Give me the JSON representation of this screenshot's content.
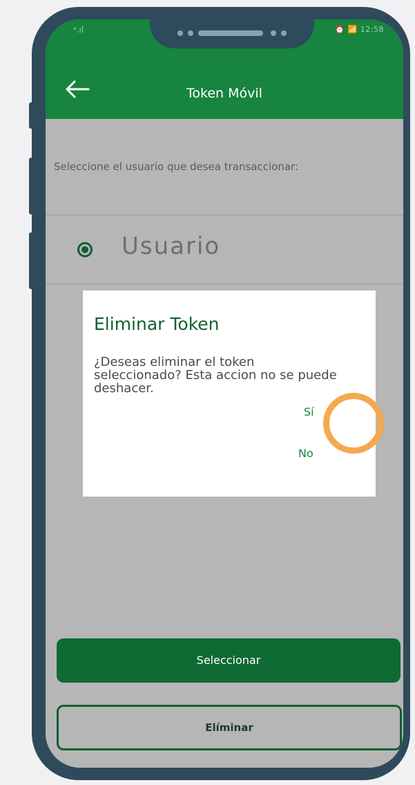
{
  "status_bar": {
    "signal": "ᵃ.ıl",
    "right": "⏰ 📶 12:58"
  },
  "header": {
    "back_icon": "arrow-left-icon",
    "title": "Token Móvil"
  },
  "main": {
    "prompt": "Seleccione el usuario que desea transaccionar:",
    "radio_option": {
      "label": "Usuario",
      "selected": true
    }
  },
  "dialog": {
    "title": "Eliminar Token",
    "message": "¿Deseas eliminar el token seleccionado? Esta accion no se puede deshacer.",
    "yes_label": "Sí",
    "no_label": "No"
  },
  "actions": {
    "select_label": "Seleccionar",
    "delete_label": "Elíminar"
  },
  "colors": {
    "primary_green": "#17843f",
    "dark_green": "#0f6a34",
    "highlight_orange": "#f4a94f",
    "phone_frame": "#2f4a5b"
  }
}
